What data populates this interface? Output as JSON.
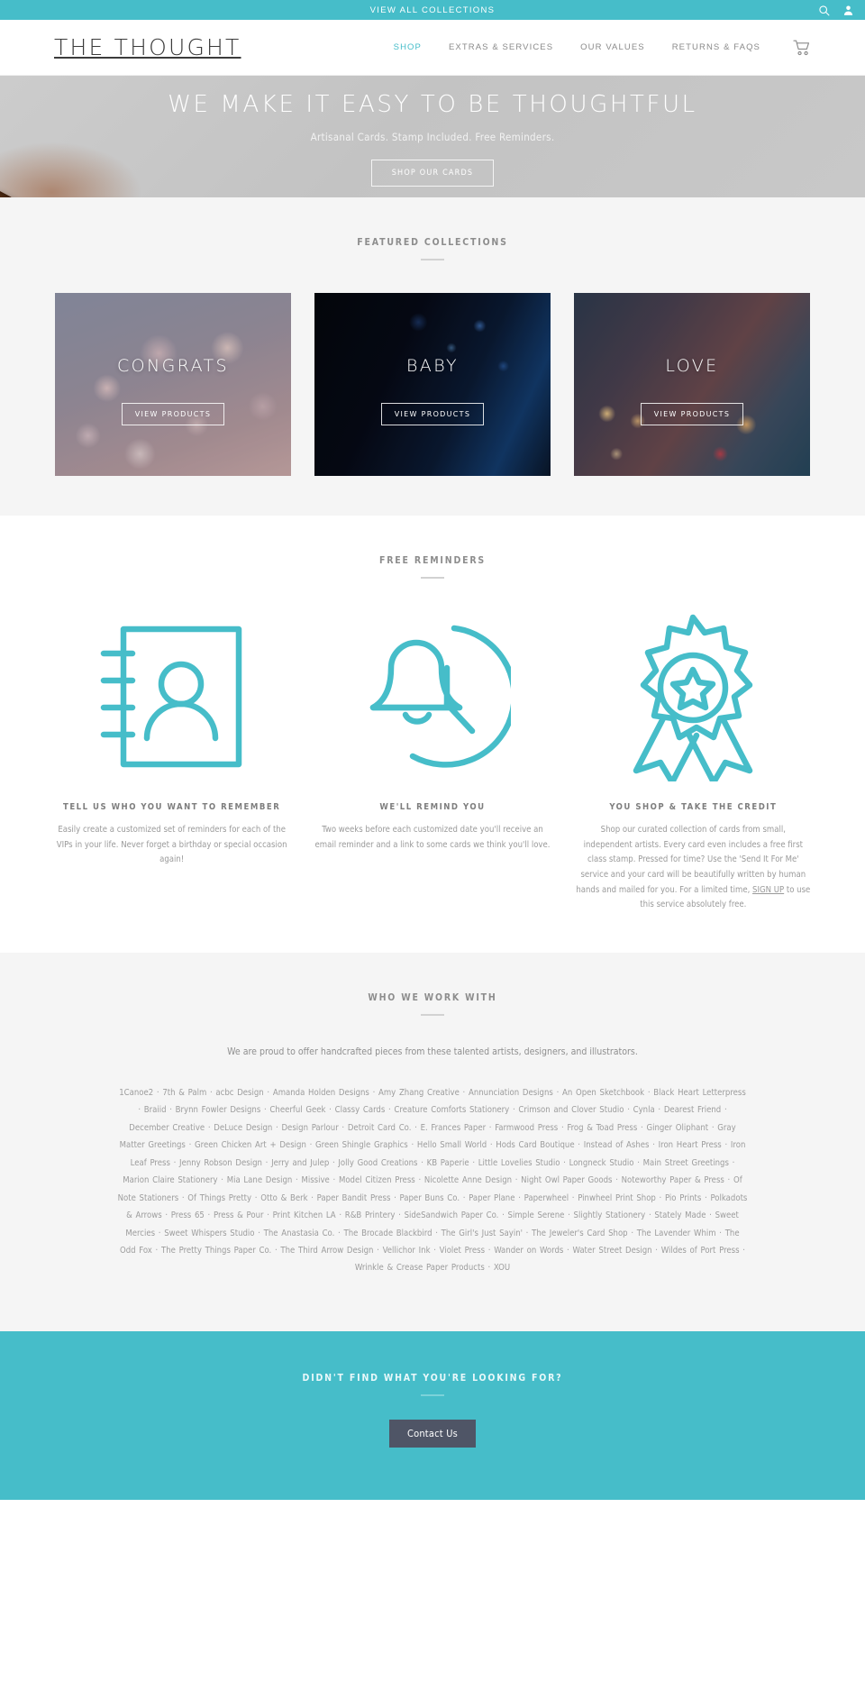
{
  "topbar": {
    "link_label": "VIEW ALL COLLECTIONS",
    "search_icon": "search-icon",
    "account_icon": "user-account-icon"
  },
  "header": {
    "brand": "THE THOUGHT",
    "nav": [
      {
        "label": "SHOP",
        "active": true
      },
      {
        "label": "EXTRAS & SERVICES",
        "active": false
      },
      {
        "label": "OUR VALUES",
        "active": false
      },
      {
        "label": "RETURNS & FAQS",
        "active": false
      }
    ],
    "cart_icon": "shopping-cart-icon"
  },
  "hero": {
    "title": "WE MAKE IT EASY TO BE THOUGHTFUL",
    "subtitle": "Artisanal Cards. Stamp Included. Free Reminders.",
    "button_label": "SHOP OUR CARDS"
  },
  "featured": {
    "title": "FEATURED COLLECTIONS",
    "cards": [
      {
        "name": "CONGRATS",
        "button_label": "VIEW PRODUCTS"
      },
      {
        "name": "BABY",
        "button_label": "VIEW PRODUCTS"
      },
      {
        "name": "LOVE",
        "button_label": "VIEW PRODUCTS"
      }
    ]
  },
  "reminders": {
    "title": "FREE REMINDERS",
    "features": [
      {
        "icon": "address-book-contact-icon",
        "title": "TELL US WHO YOU WANT TO REMEMBER",
        "body": "Easily create a customized set of reminders for each of the VIPs in your life. Never forget a birthday or special occasion again!"
      },
      {
        "icon": "bell-clock-icon",
        "title": "WE'LL REMIND YOU",
        "body": "Two weeks before each customized date you'll receive an email reminder and a link to some cards we think you'll love."
      },
      {
        "icon": "award-ribbon-star-icon",
        "title": "YOU SHOP & TAKE THE CREDIT",
        "body_part1": "Shop our curated collection of cards from small, independent artists. Every card even includes a free first class stamp. Pressed for time? Use the 'Send It For Me' service and your card will be beautifully written by human hands and mailed for you. For a limited time, ",
        "body_link": "SIGN UP",
        "body_part2": " to use this service absolutely free."
      }
    ]
  },
  "partners": {
    "title": "WHO WE WORK WITH",
    "lead": "We are proud to offer handcrafted pieces from these talented artists, designers, and illustrators.",
    "separator": "·",
    "names": [
      "1Canoe2",
      "7th & Palm",
      "acbc Design",
      "Amanda Holden Designs",
      "Amy Zhang Creative",
      "Annunciation Designs",
      "An Open Sketchbook",
      "Black Heart Letterpress",
      "Braiid",
      "Brynn Fowler Designs",
      "Cheerful Geek",
      "Classy Cards",
      "Creature Comforts Stationery",
      "Crimson and Clover Studio",
      "Cynla",
      "Dearest Friend",
      "December Creative",
      "DeLuce Design",
      "Design Parlour",
      "Detroit Card Co.",
      "E. Frances Paper",
      "Farmwood Press",
      "Frog & Toad Press",
      "Ginger Oliphant",
      "Gray Matter Greetings",
      "Green Chicken Art + Design",
      "Green Shingle Graphics",
      "Hello Small World",
      "Hods Card Boutique",
      "Instead of Ashes",
      "Iron Heart Press",
      "Iron Leaf Press",
      "Jenny Robson Design",
      "Jerry and Julep",
      "Jolly Good Creations",
      "KB Paperie",
      "Little Lovelies Studio",
      "Longneck Studio",
      "Main Street Greetings",
      "Marion Claire Stationery",
      "Mia Lane Design",
      "Missive",
      "Model Citizen Press",
      "Nicolette Anne Design",
      "Night Owl Paper Goods",
      "Noteworthy Paper & Press",
      "Of Note Stationers",
      "Of Things Pretty",
      "Otto & Berk",
      "Paper Bandit Press",
      "Paper Buns Co.",
      "Paper Plane",
      "Paperwheel",
      "Pinwheel Print Shop",
      "Pio Prints",
      "Polkadots & Arrows",
      "Press 65",
      "Press &  Pour",
      "Print Kitchen LA",
      "R&B Printery",
      "SideSandwich Paper Co.",
      "Simple Serene",
      "Slightly Stationery",
      "Stately Made",
      "Sweet Mercies",
      "Sweet Whispers Studio",
      "The Anastasia Co.",
      "The Brocade Blackbird",
      "The Girl's Just Sayin'",
      "The Jeweler's Card Shop",
      "The Lavender Whim",
      "The Odd Fox",
      "The Pretty Things Paper Co.",
      "The Third Arrow Design",
      "Vellichor Ink",
      "Violet Press",
      "Wander on Words",
      "Water Street Design",
      "Wildes of Port Press",
      "Wrinkle & Crease Paper Products",
      "XOU"
    ]
  },
  "cta": {
    "title": "DIDN'T FIND WHAT YOU'RE LOOKING FOR?",
    "button_label": "Contact Us"
  },
  "colors": {
    "brand_teal": "#46bdc9",
    "cta_button": "#4f5566",
    "muted_text": "#9a9a9a",
    "section_grey": "#f5f5f5"
  }
}
